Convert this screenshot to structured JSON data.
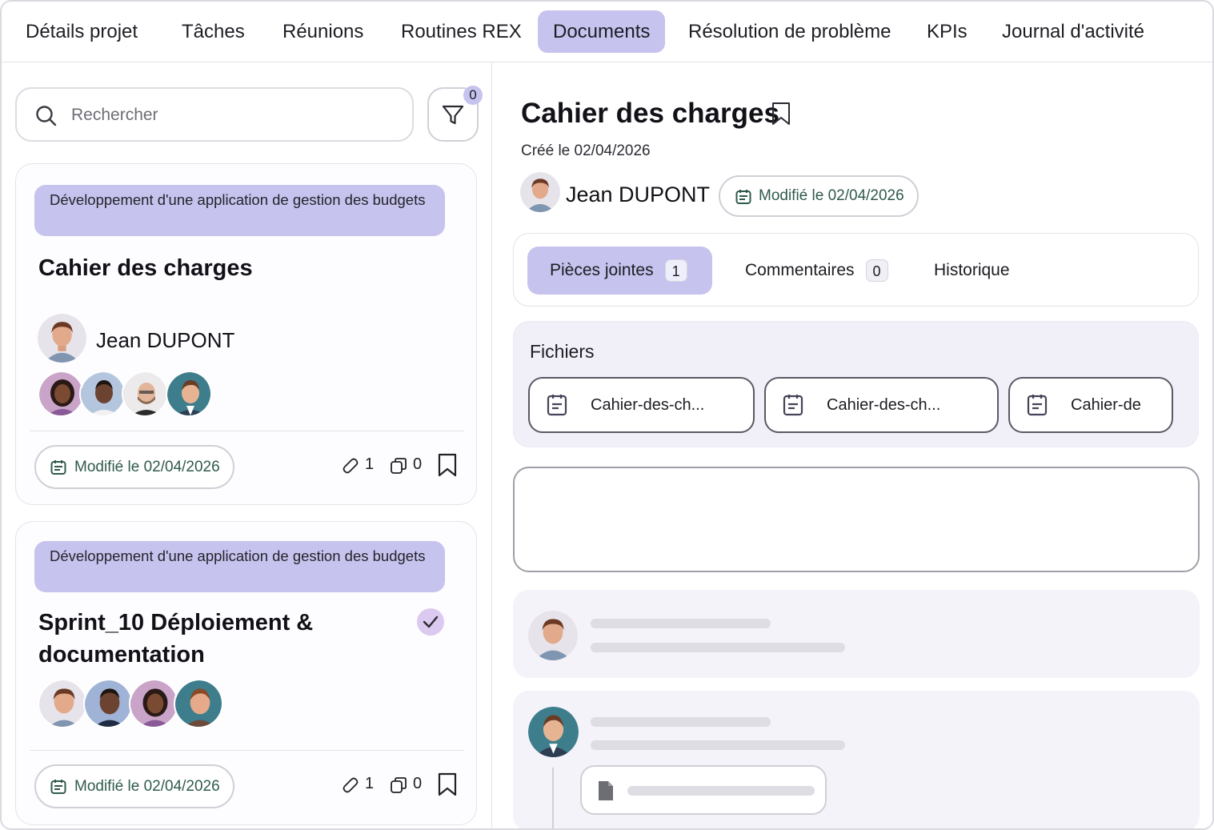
{
  "tabs": [
    "Détails projet",
    "Tâches",
    "Réunions",
    "Routines REX",
    "Documents",
    "Résolution de problème",
    "KPIs",
    "Journal d'activité"
  ],
  "search": {
    "placeholder": "Rechercher"
  },
  "filter": {
    "count": "0"
  },
  "cards": [
    {
      "project": "Développement d'une application de gestion des budgets",
      "title": "Cahier des charges",
      "owner": "Jean DUPONT",
      "modified": "Modifié le 02/04/2026",
      "attachments": "1",
      "comments": "0"
    },
    {
      "project": "Développement d'une application de gestion des budgets",
      "title": "Sprint_10 Déploiement & documentation",
      "modified": "Modifié le 02/04/2026",
      "attachments": "1",
      "comments": "0"
    }
  ],
  "detail": {
    "title": "Cahier des charges",
    "created": "Créé le 02/04/2026",
    "owner": "Jean DUPONT",
    "modified": "Modifié le 02/04/2026",
    "tabs": {
      "attachments": "Pièces jointes",
      "attachments_count": "1",
      "comments": "Commentaires",
      "comments_count": "0",
      "history": "Historique"
    },
    "files_heading": "Fichiers",
    "files": [
      "Cahier-des-ch...",
      "Cahier-des-ch...",
      "Cahier-de"
    ]
  },
  "colors": {
    "accent": "#c6c3ee",
    "date_text": "#2f5a4c"
  }
}
